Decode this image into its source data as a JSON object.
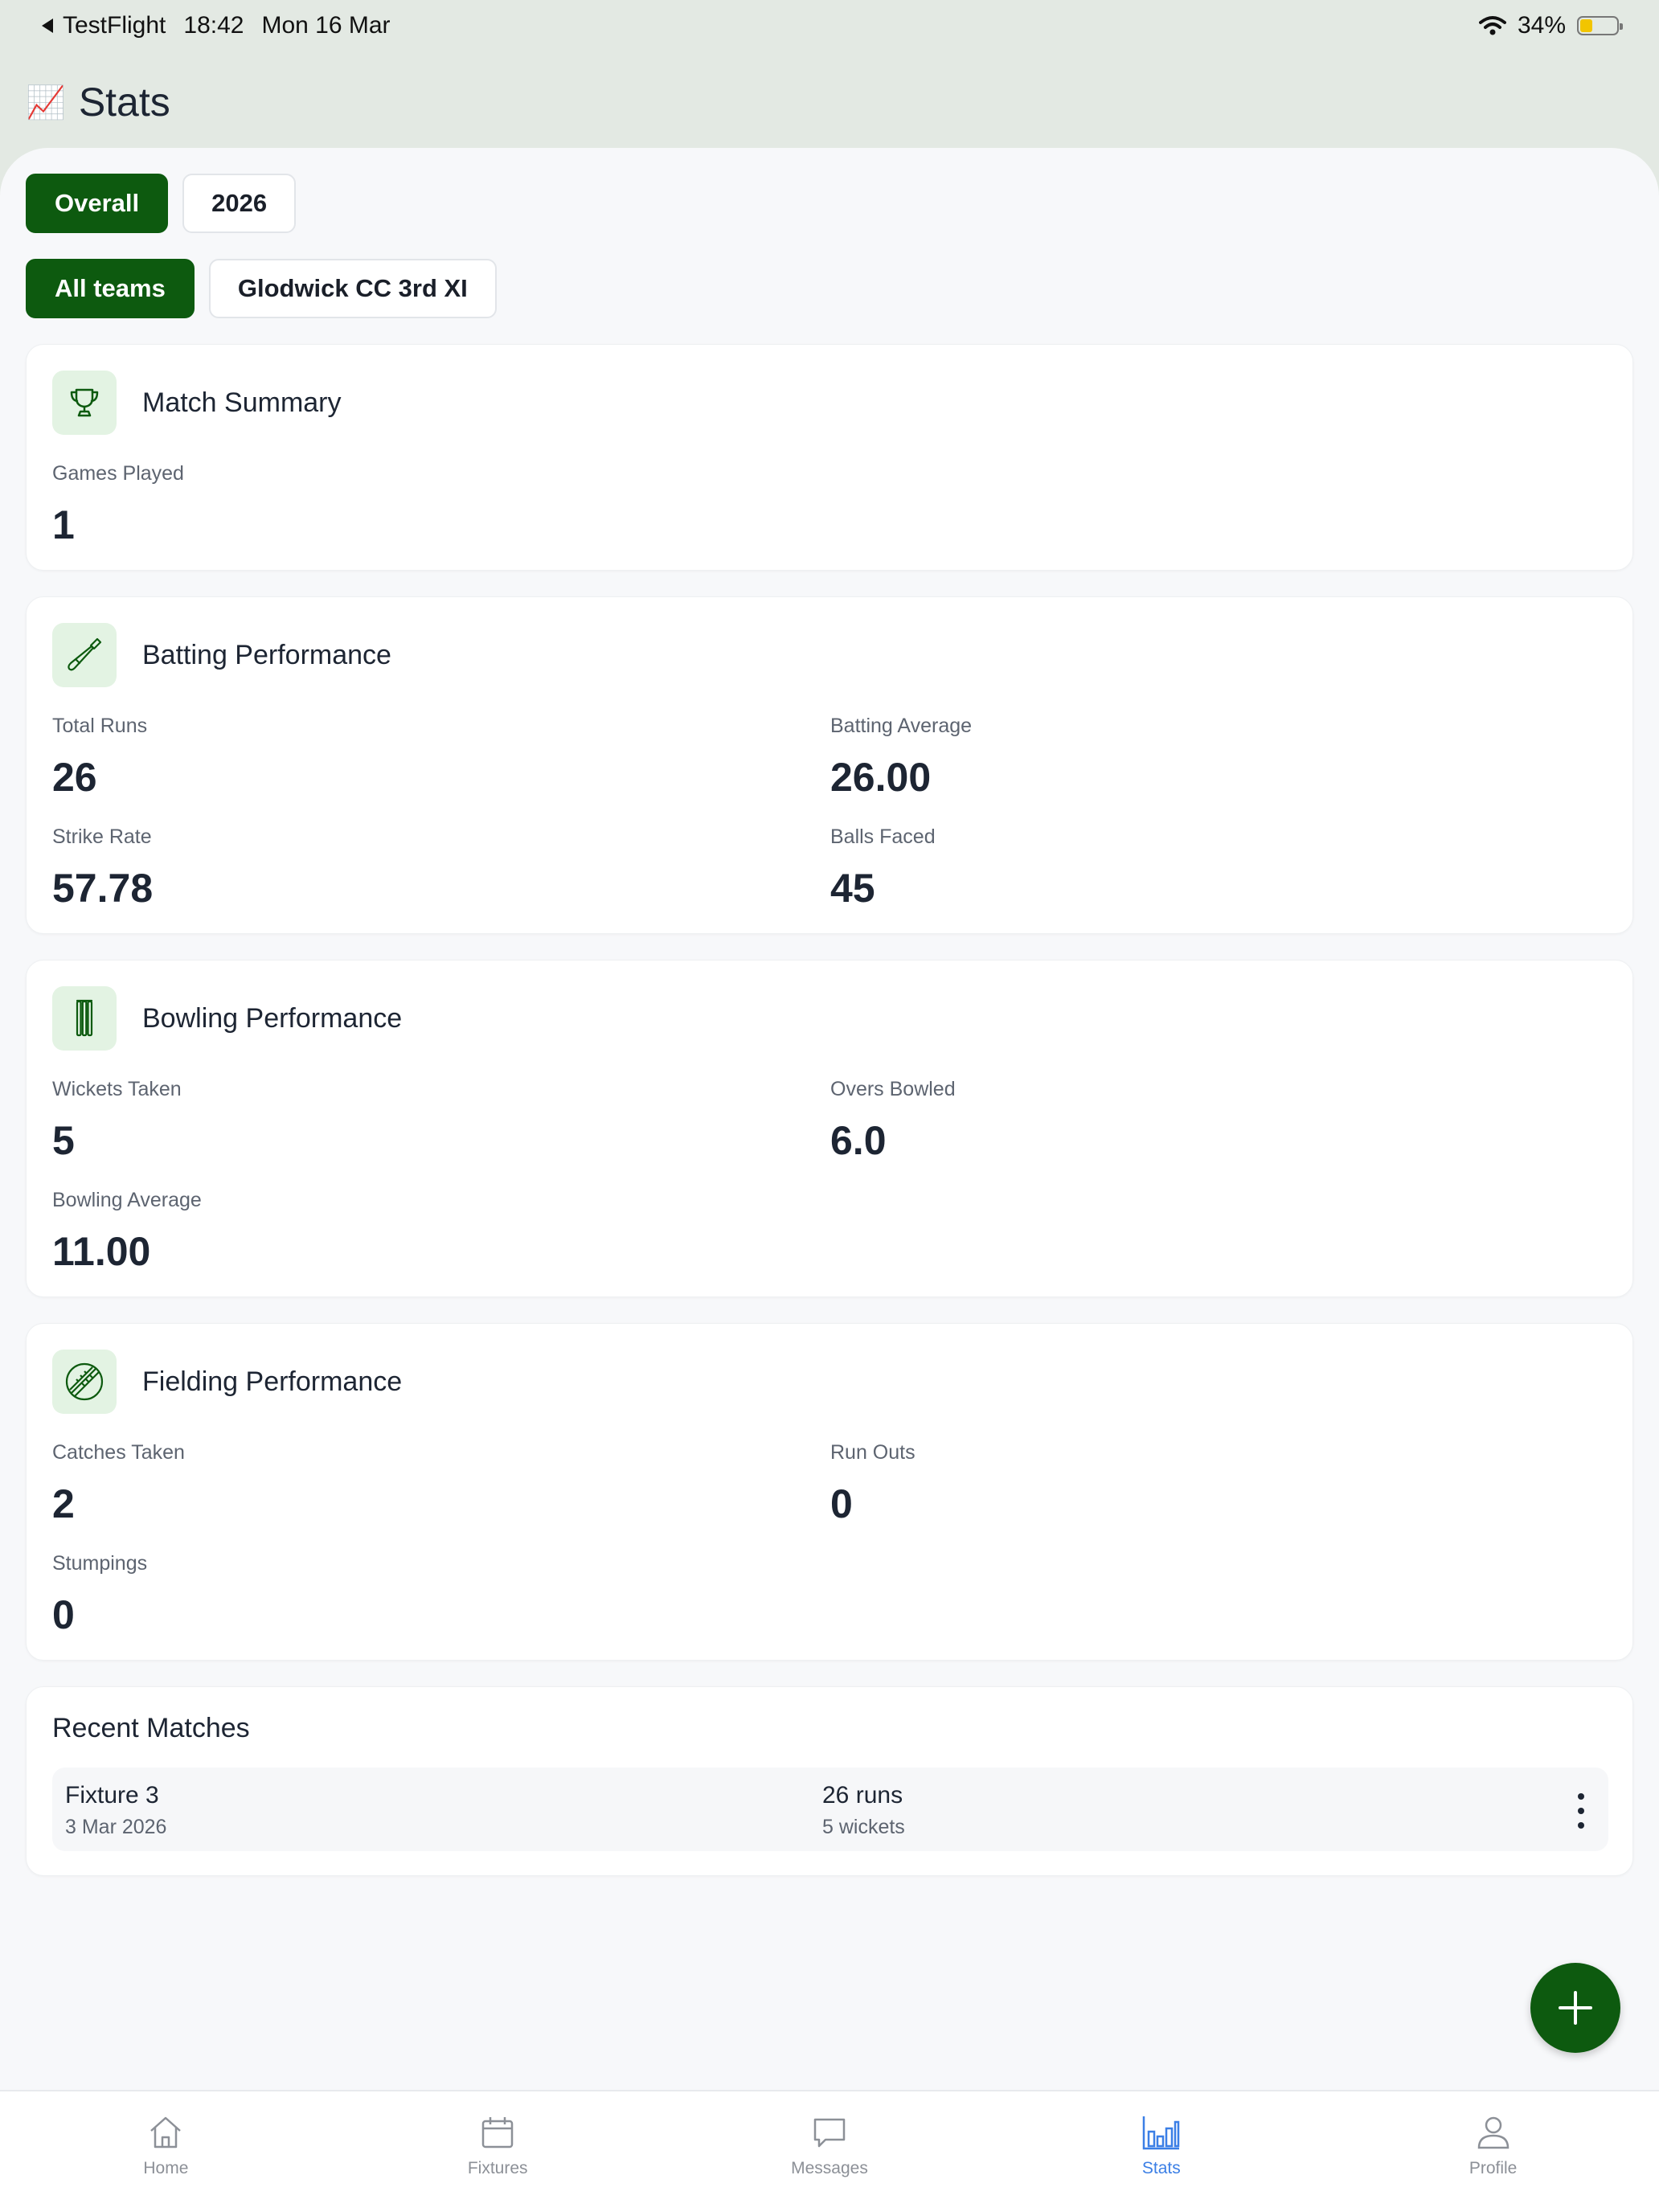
{
  "status_bar": {
    "back_app": "TestFlight",
    "time": "18:42",
    "date": "Mon 16 Mar",
    "battery": "34%",
    "battery_level": 0.34
  },
  "header": {
    "emoji": "📈",
    "title": "Stats"
  },
  "period_filters": [
    {
      "label": "Overall",
      "active": true
    },
    {
      "label": "2026",
      "active": false
    }
  ],
  "team_filters": [
    {
      "label": "All teams",
      "active": true
    },
    {
      "label": "Glodwick CC 3rd XI",
      "active": false
    }
  ],
  "match_summary": {
    "title": "Match Summary",
    "icon": "trophy-icon",
    "games_played": {
      "label": "Games Played",
      "value": "1"
    }
  },
  "batting": {
    "title": "Batting Performance",
    "icon": "cricket-bat-icon",
    "total_runs": {
      "label": "Total Runs",
      "value": "26"
    },
    "batting_average": {
      "label": "Batting Average",
      "value": "26.00"
    },
    "strike_rate": {
      "label": "Strike Rate",
      "value": "57.78"
    },
    "balls_faced": {
      "label": "Balls Faced",
      "value": "45"
    }
  },
  "bowling": {
    "title": "Bowling Performance",
    "icon": "wicket-stumps-icon",
    "wickets_taken": {
      "label": "Wickets Taken",
      "value": "5"
    },
    "overs_bowled": {
      "label": "Overs Bowled",
      "value": "6.0"
    },
    "bowling_average": {
      "label": "Bowling Average",
      "value": "11.00"
    }
  },
  "fielding": {
    "title": "Fielding Performance",
    "icon": "cricket-ball-icon",
    "catches_taken": {
      "label": "Catches Taken",
      "value": "2"
    },
    "run_outs": {
      "label": "Run Outs",
      "value": "0"
    },
    "stumpings": {
      "label": "Stumpings",
      "value": "0"
    }
  },
  "recent_matches": {
    "title": "Recent Matches",
    "items": [
      {
        "name": "Fixture 3",
        "date": "3 Mar 2026",
        "runs": "26 runs",
        "wickets": "5 wickets"
      }
    ]
  },
  "tabs": [
    {
      "label": "Home",
      "icon": "home-icon",
      "active": false
    },
    {
      "label": "Fixtures",
      "icon": "calendar-icon",
      "active": false
    },
    {
      "label": "Messages",
      "icon": "message-icon",
      "active": false
    },
    {
      "label": "Stats",
      "icon": "bar-chart-icon",
      "active": true
    },
    {
      "label": "Profile",
      "icon": "person-icon",
      "active": false
    }
  ],
  "colors": {
    "brand_green": "#0d5a0f",
    "active_tab": "#3b7fe6",
    "icon_bg": "#e3f3e3"
  }
}
